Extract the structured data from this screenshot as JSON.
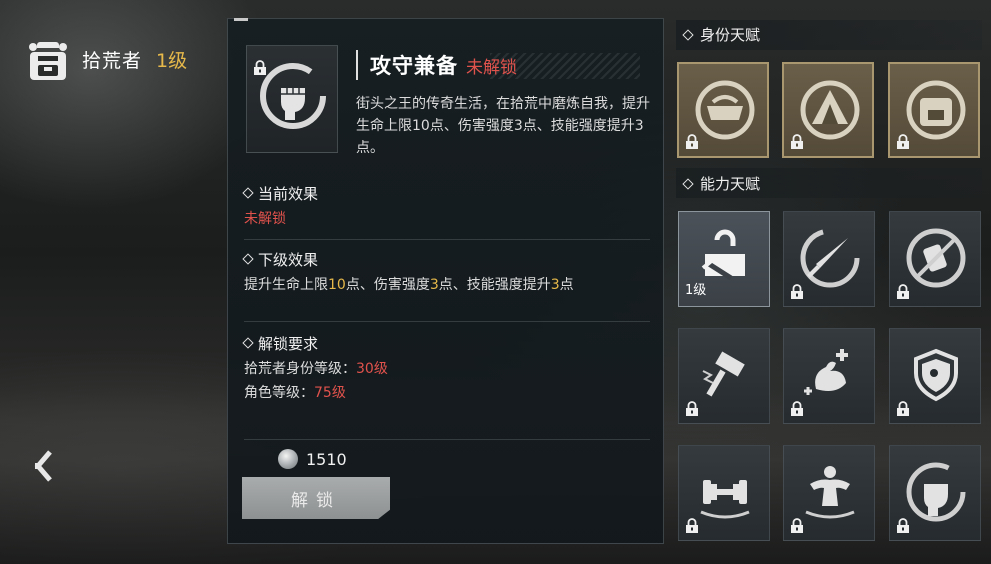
{
  "header": {
    "name": "拾荒者",
    "level": "1级"
  },
  "detail": {
    "title": "攻守兼备",
    "status": "未解锁",
    "description": "街头之王的传奇生活，在拾荒中磨炼自我，提升生命上限10点、伤害强度3点、技能强度提升3点。",
    "current_effect": {
      "heading": "当前效果",
      "value": "未解锁"
    },
    "next_effect": {
      "heading": "下级效果",
      "seg1": "提升生命上限",
      "v1": "10",
      "seg2": "点、伤害强度",
      "v2": "3",
      "seg3": "点、技能强度提升",
      "v3": "3",
      "seg4": "点"
    },
    "requirements": {
      "heading": "解锁要求",
      "req1_label": "拾荒者身份等级：",
      "req1_value": "30级",
      "req2_label": "角色等级：",
      "req2_value": "75级"
    },
    "cost": "1510",
    "unlock_label": "解锁"
  },
  "identity_talents": {
    "heading": "身份天赋",
    "items": [
      {
        "icon": "scavenger-emblem-icon",
        "locked": true
      },
      {
        "icon": "tent-emblem-icon",
        "locked": true
      },
      {
        "icon": "backpack-emblem-icon",
        "locked": true
      }
    ]
  },
  "ability_talents": {
    "heading": "能力天赋",
    "items": [
      {
        "icon": "toolbox-icon",
        "level": "1级",
        "locked": false
      },
      {
        "icon": "knife-icon",
        "locked": true
      },
      {
        "icon": "no-can-icon",
        "locked": true
      },
      {
        "icon": "hammer-icon",
        "locked": true
      },
      {
        "icon": "muscle-plus-icon",
        "locked": true
      },
      {
        "icon": "shield-icon",
        "locked": true
      },
      {
        "icon": "dumbbell-icon",
        "locked": true
      },
      {
        "icon": "bodybuilder-icon",
        "locked": true
      },
      {
        "icon": "fist-icon",
        "locked": true
      }
    ]
  },
  "colors": {
    "locked_red": "#e0524c",
    "level_gold": "#e7b94a"
  }
}
